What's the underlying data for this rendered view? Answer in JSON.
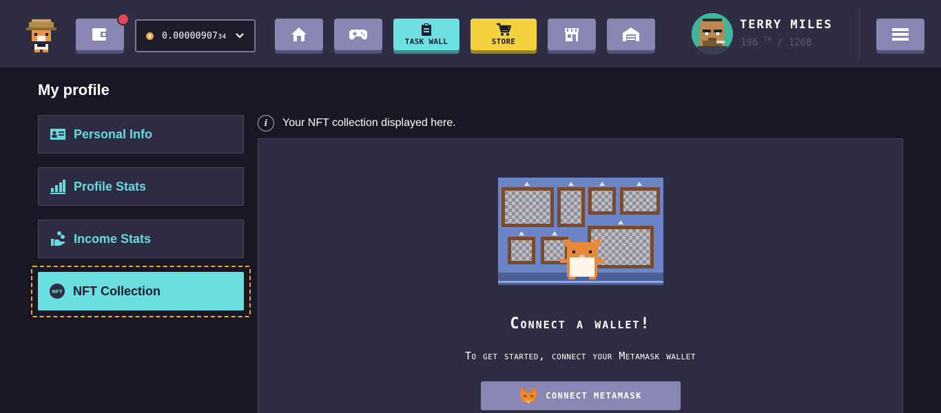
{
  "header": {
    "wallet_icon": "wallet-icon",
    "balance": {
      "main": "0.00000907",
      "small": "34",
      "currency_icon": "bitcoin-coin-icon"
    },
    "nav": {
      "task_wall_label": "TASK WALL",
      "store_label": "STORE"
    },
    "user": {
      "name": "TERRY MILES",
      "rank": "196",
      "rank_suffix": "TH",
      "rank_total": "/ 1268"
    }
  },
  "sidebar": {
    "title": "My profile",
    "items": [
      {
        "label": "Personal Info",
        "icon": "id-card-icon"
      },
      {
        "label": "Profile Stats",
        "icon": "bar-chart-icon"
      },
      {
        "label": "Income Stats",
        "icon": "coins-hand-icon"
      },
      {
        "label": "NFT Collection",
        "icon": "nft-icon",
        "active": true
      }
    ]
  },
  "content": {
    "info_text": "Your NFT collection displayed here.",
    "connect_title": "Connect a wallet!",
    "connect_subtitle": "To get started, connect your Metamask wallet",
    "connect_button_label": "connect metamask"
  },
  "colors": {
    "header_bg": "#2e2d44",
    "page_bg": "#181824",
    "accent_cyan": "#6adfe1",
    "accent_yellow": "#f4d23f",
    "button_purple": "#8a86b4",
    "focus_orange": "#f2a92e"
  }
}
